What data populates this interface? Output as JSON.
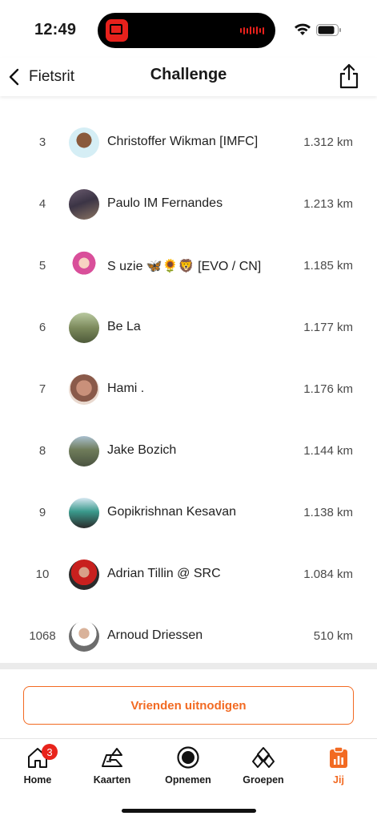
{
  "status": {
    "time": "12:49"
  },
  "header": {
    "back_label": "Fietsrit",
    "title": "Challenge"
  },
  "leaderboard": [
    {
      "rank": "3",
      "name": "Christoffer  Wikman [IMFC]",
      "distance": "1.312 km"
    },
    {
      "rank": "4",
      "name": "Paulo IM Fernandes",
      "distance": "1.213 km"
    },
    {
      "rank": "5",
      "name": "S uzie 🦋🌻🦁 [EVO / CN]",
      "distance": "1.185 km"
    },
    {
      "rank": "6",
      "name": "Be La",
      "distance": "1.177 km"
    },
    {
      "rank": "7",
      "name": "Hami .",
      "distance": "1.176 km"
    },
    {
      "rank": "8",
      "name": "Jake Bozich",
      "distance": "1.144 km"
    },
    {
      "rank": "9",
      "name": "Gopikrishnan Kesavan",
      "distance": "1.138 km"
    },
    {
      "rank": "10",
      "name": "Adrian Tillin @ SRC",
      "distance": "1.084 km"
    },
    {
      "rank": "1068",
      "name": "Arnoud Driessen",
      "distance": "510 km"
    }
  ],
  "invite": {
    "label": "Vrienden uitnodigen"
  },
  "tabs": [
    {
      "label": "Home",
      "icon": "home-icon",
      "badge": "3"
    },
    {
      "label": "Kaarten",
      "icon": "maps-icon"
    },
    {
      "label": "Opnemen",
      "icon": "record-icon"
    },
    {
      "label": "Groepen",
      "icon": "groups-icon"
    },
    {
      "label": "Jij",
      "icon": "profile-stats-icon"
    }
  ],
  "colors": {
    "accent": "#f26a22",
    "badge": "#e8231b"
  }
}
